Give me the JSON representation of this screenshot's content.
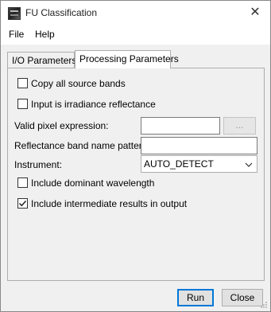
{
  "window": {
    "title": "FU Classification",
    "close_symbol": "✕",
    "app_icon": "snap-app-icon"
  },
  "menu": {
    "items": [
      "File",
      "Help"
    ]
  },
  "tabs": [
    {
      "label": "I/O Parameters",
      "selected": false
    },
    {
      "label": "Processing Parameters",
      "selected": true
    }
  ],
  "params": {
    "copy_source_bands": {
      "label": "Copy all source bands",
      "checked": false
    },
    "irradiance_reflectance": {
      "label": "Input is irradiance reflectance",
      "checked": false
    },
    "valid_pixel_expression": {
      "label": "Valid pixel expression:",
      "value": "",
      "button_label": "..."
    },
    "reflectance_pattern": {
      "label": "Reflectance band name pattern:",
      "value": ""
    },
    "instrument": {
      "label": "Instrument:",
      "value": "AUTO_DETECT"
    },
    "dominant_wavelength": {
      "label": "Include dominant wavelength",
      "checked": false
    },
    "intermediate_results": {
      "label": "Include intermediate results in output",
      "checked": true
    }
  },
  "buttons": {
    "run": "Run",
    "close": "Close"
  }
}
